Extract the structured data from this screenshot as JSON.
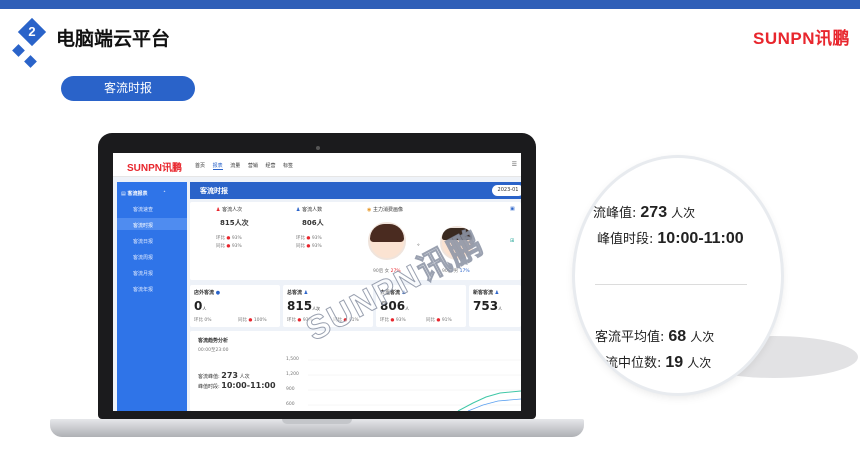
{
  "header": {
    "step_number": "2",
    "title": "电脑端云平台",
    "brand": "SUNPN讯鹏",
    "section_button": "客流时报"
  },
  "screen": {
    "logo": "SUNPN讯鹏",
    "nav": [
      "首页",
      "报表",
      "流量",
      "营销",
      "经营",
      "标签"
    ],
    "nav_active": 1,
    "sidebar_title": "客流报表",
    "sidebar_items": [
      "客流速查",
      "客流时报",
      "客流日报",
      "客流周报",
      "客流月报",
      "客流年报"
    ],
    "sidebar_active": 1,
    "header_title": "客流时报",
    "date": "2023-01",
    "stats": {
      "visits_label": "客流人次",
      "visits_value": "815人次",
      "people_label": "客流人数",
      "people_value": "806人",
      "ring_label": "环比",
      "yoy_label": "同比",
      "pct": "93%",
      "portrait_title": "主力消费画像",
      "female_label": "90后 女",
      "female_pct": "27%",
      "male_label": "90后 男",
      "male_pct": "17%"
    },
    "cards": [
      {
        "label": "店外客流",
        "value": "0",
        "unit": "人",
        "ring": "环比 0%",
        "yoy": "同比",
        "yoy_pct": "100%"
      },
      {
        "label": "总客流",
        "value": "815",
        "unit": "人次",
        "ring": "环比",
        "ring_pct": "93%",
        "yoy": "同比",
        "yoy_pct": "91%"
      },
      {
        "label": "去重客流",
        "value": "806",
        "unit": "人",
        "ring": "环比",
        "ring_pct": "93%",
        "yoy": "同比",
        "yoy_pct": "91%"
      },
      {
        "label": "新客客流",
        "value": "753",
        "unit": "人"
      }
    ],
    "trend": {
      "title": "客流趋势分析",
      "time": "00:00至23:00",
      "peak_label": "客流峰值:",
      "peak_value": "273",
      "peak_unit": "人次",
      "peak_time_label": "峰值时段:",
      "peak_time": "10:00-11:00",
      "y_ticks": [
        "1,500",
        "1,200",
        "900",
        "600"
      ]
    }
  },
  "zoom": {
    "peak_label": "流峰值:",
    "peak_value": "273",
    "peak_unit": "人次",
    "peak_time_label": "峰值时段:",
    "peak_time": "10:00-11:00",
    "avg_label": "客流平均值:",
    "avg_value": "68",
    "avg_unit": "人次",
    "median_label": "流中位数:",
    "median_value": "19",
    "median_unit": "人次"
  },
  "watermark": "SUNPN讯鹏",
  "colors": {
    "brand_red": "#e8262d",
    "primary_blue": "#2a63c9",
    "sidebar_blue": "#2f74e8"
  }
}
